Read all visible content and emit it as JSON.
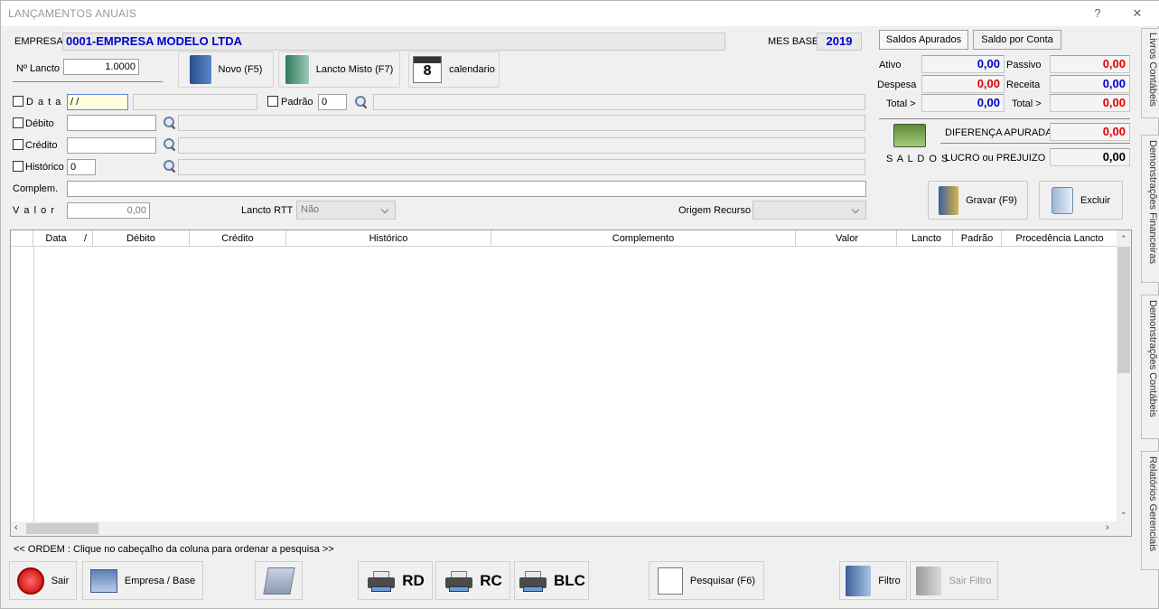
{
  "window": {
    "title": "LANÇAMENTOS ANUAIS",
    "help": "?",
    "close": "✕"
  },
  "header": {
    "empresa_label": "EMPRESA",
    "empresa_value": "0001-EMPRESA MODELO LTDA",
    "mes_base_label": "MES BASE",
    "mes_base_value": "2019"
  },
  "form": {
    "nlancto_label": "Nº Lancto",
    "nlancto_value": "1.0000",
    "data_label": "D a t a",
    "data_value": "/ /",
    "padrao_label": "Padrão",
    "padrao_value": "0",
    "debito_label": "Débito",
    "credito_label": "Crédito",
    "historico_label": "Histórico",
    "historico_value": "0",
    "complem_label": "Complem.",
    "valor_label": "V a l o r",
    "valor_value": "0,00",
    "rtt_label": "Lancto RTT",
    "rtt_value": "Não",
    "origem_label": "Origem Recurso",
    "origem_value": ""
  },
  "toolbar": {
    "novo": "Novo (F5)",
    "misto": "Lancto Misto (F7)",
    "calendario": "calendario",
    "calendar_day": "8"
  },
  "saldos": {
    "tab_apurados": "Saldos Apurados",
    "tab_conta": "Saldo por Conta",
    "ativo_label": "Ativo",
    "ativo": "0,00",
    "passivo_label": "Passivo",
    "passivo": "0,00",
    "despesa_label": "Despesa",
    "despesa": "0,00",
    "receita_label": "Receita",
    "receita": "0,00",
    "total_label_left": "Total >",
    "total_left": "0,00",
    "total_label_right": "Total >",
    "total_right": "0,00",
    "saldos_label": "S A L D O S",
    "diferenca_label": "DIFERENÇA  APURADA",
    "diferenca": "0,00",
    "lucro_label": "LUCRO ou PREJUIZO",
    "lucro": "0,00"
  },
  "actions": {
    "gravar": "Gravar (F9)",
    "excluir": "Excluir"
  },
  "grid": {
    "columns": [
      "Data",
      "/",
      "Débito",
      "Crédito",
      "Histórico",
      "Complemento",
      "Valor",
      "Lancto",
      "Padrão",
      "Procedência Lancto"
    ]
  },
  "ordem_hint": "<< ORDEM : Clique no cabeçalho da coluna para ordenar a pesquisa >>",
  "bottom": {
    "sair": "Sair",
    "empresa_base": "Empresa / Base",
    "rd": "RD",
    "rc": "RC",
    "blc": "BLC",
    "pesquisar": "Pesquisar (F6)",
    "filtro": "Filtro",
    "sair_filtro": "Sair Filtro"
  },
  "side_tabs": [
    "Livros Contábeis",
    "Demonstrações Financeiras",
    "Demonstrações Contábeis",
    "Relatórios Gerenciais"
  ],
  "colors": {
    "blue_value": "#0000cc",
    "red_value": "#e00000"
  }
}
